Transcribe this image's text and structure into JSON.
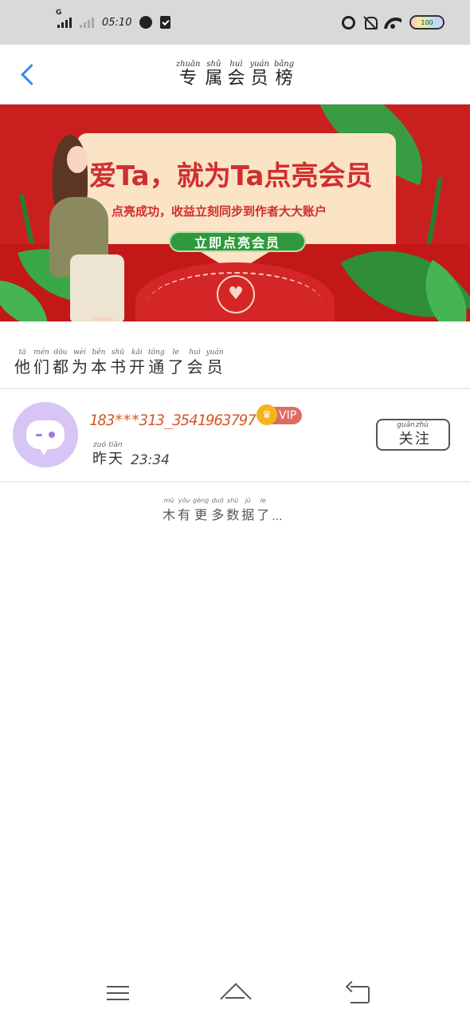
{
  "status_bar": {
    "time": "05:10",
    "network_label": "G",
    "battery_level": "100"
  },
  "header": {
    "title": [
      {
        "hz": "专",
        "py": "zhuān"
      },
      {
        "hz": "属",
        "py": "shǔ"
      },
      {
        "hz": "会",
        "py": "huì"
      },
      {
        "hz": "员",
        "py": "yuán"
      },
      {
        "hz": "榜",
        "py": "bǎng"
      }
    ]
  },
  "banner": {
    "title": "爱Ta，就为Ta点亮会员",
    "subtitle": "点亮成功，收益立刻同步到作者大大账户",
    "button_label": "立即点亮会员"
  },
  "section_caption": [
    {
      "hz": "他",
      "py": "tā"
    },
    {
      "hz": "们",
      "py": "mén"
    },
    {
      "hz": "都",
      "py": "dōu"
    },
    {
      "hz": "为",
      "py": "wèi"
    },
    {
      "hz": "本",
      "py": "běn"
    },
    {
      "hz": "书",
      "py": "shū"
    },
    {
      "hz": "开",
      "py": "kāi"
    },
    {
      "hz": "通",
      "py": "tōng"
    },
    {
      "hz": "了",
      "py": "le"
    },
    {
      "hz": "会",
      "py": "huì"
    },
    {
      "hz": "员",
      "py": "yuán"
    }
  ],
  "members": [
    {
      "name": "183***313_3541963797",
      "badge": "VIP",
      "time_word": [
        {
          "hz": "昨",
          "py": "zuó"
        },
        {
          "hz": "天",
          "py": "tiān"
        }
      ],
      "time": "23:34",
      "follow_label": [
        {
          "hz": "关",
          "py": "guān"
        },
        {
          "hz": "注",
          "py": "zhù"
        }
      ]
    }
  ],
  "no_more": {
    "chars": [
      {
        "hz": "木",
        "py": "mù"
      },
      {
        "hz": "有",
        "py": "yǒu"
      },
      {
        "hz": "更",
        "py": "gèng"
      },
      {
        "hz": "多",
        "py": "duō"
      },
      {
        "hz": "数",
        "py": "shù"
      },
      {
        "hz": "据",
        "py": "jù"
      },
      {
        "hz": "了",
        "py": "le"
      }
    ],
    "ellipsis": "..."
  },
  "colors": {
    "accent_blue": "#2b8ef0",
    "banner_red": "#c91f1f",
    "member_name": "#d45a2c",
    "vip_badge": "#e06b66",
    "avatar_bg": "#d6c5f5"
  },
  "icons": {
    "back": "chevron-left-icon",
    "crown": "crown-icon",
    "nav_menu": "menu-icon",
    "nav_home": "home-icon",
    "nav_back": "back-icon"
  }
}
